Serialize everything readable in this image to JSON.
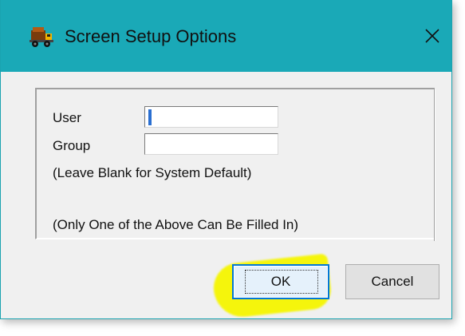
{
  "window": {
    "title": "Screen Setup Options",
    "close_glyph": "✕",
    "app_icon": "dump-truck-icon",
    "titlebar_color": "#1aa9b7"
  },
  "form": {
    "user_label": "User",
    "user_value": "",
    "group_label": "Group",
    "group_value": "",
    "hint_blank": "(Leave Blank for System Default)",
    "hint_one": "(Only One of the Above Can Be Filled In)"
  },
  "buttons": {
    "ok_label": "OK",
    "cancel_label": "Cancel"
  },
  "annotation": {
    "highlight_color": "#f6f600"
  }
}
